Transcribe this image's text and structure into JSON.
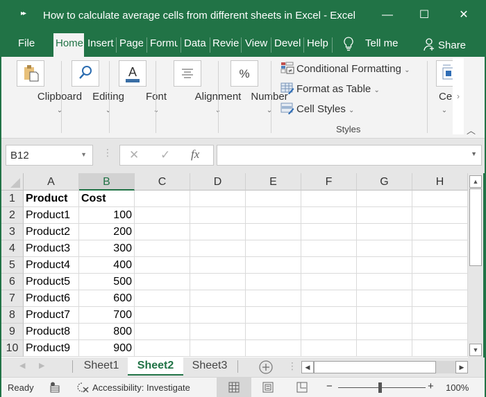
{
  "window": {
    "title": "How to calculate average cells from different sheets in Excel  -  Excel",
    "quick_access_icon": "more-icon",
    "minimize": "—",
    "maximize": "☐",
    "close": "✕"
  },
  "tabs": [
    {
      "label": "File",
      "active": false
    },
    {
      "label": "Home",
      "active": true
    },
    {
      "label": "Insert",
      "active": false
    },
    {
      "label": "Page",
      "active": false
    },
    {
      "label": "Formu",
      "active": false
    },
    {
      "label": "Data",
      "active": false
    },
    {
      "label": "Revie",
      "active": false
    },
    {
      "label": "View",
      "active": false
    },
    {
      "label": "Devel",
      "active": false
    },
    {
      "label": "Help",
      "active": false
    }
  ],
  "tell_me": {
    "label": "Tell me",
    "icon": "lightbulb-icon"
  },
  "share": {
    "label": "Share",
    "icon": "person-add-icon"
  },
  "ribbon": {
    "groups": [
      {
        "label": "Clipboard",
        "icon": "clipboard-icon"
      },
      {
        "label": "Editing",
        "icon": "search-icon"
      },
      {
        "label": "Font",
        "icon": "font-color-icon"
      },
      {
        "label": "Alignment",
        "icon": "align-center-icon"
      },
      {
        "label": "Number",
        "icon": "percent-icon"
      }
    ],
    "styles": {
      "items": [
        {
          "label": "Conditional Formatting",
          "icon": "conditional-formatting-icon"
        },
        {
          "label": "Format as Table",
          "icon": "format-table-icon"
        },
        {
          "label": "Cell Styles",
          "icon": "cell-styles-icon"
        }
      ],
      "group_label": "Styles"
    },
    "cells_group": {
      "label": "Ce"
    },
    "collapse_icon": "chevron-up-icon"
  },
  "formula_bar": {
    "name_box": "B12",
    "cancel_icon": "✕",
    "enter_icon": "✓",
    "fx_label": "fx",
    "formula": ""
  },
  "grid": {
    "columns": [
      "A",
      "B",
      "C",
      "D",
      "E",
      "F",
      "G",
      "H"
    ],
    "selected_column": "B",
    "rows": [
      {
        "n": "1",
        "a": "Product",
        "b": "Cost",
        "header": true
      },
      {
        "n": "2",
        "a": "Product1",
        "b": "100"
      },
      {
        "n": "3",
        "a": "Product2",
        "b": "200"
      },
      {
        "n": "4",
        "a": "Product3",
        "b": "300"
      },
      {
        "n": "5",
        "a": "Product4",
        "b": "400"
      },
      {
        "n": "6",
        "a": "Product5",
        "b": "500"
      },
      {
        "n": "7",
        "a": "Product6",
        "b": "600"
      },
      {
        "n": "8",
        "a": "Product7",
        "b": "700"
      },
      {
        "n": "9",
        "a": "Product8",
        "b": "800"
      },
      {
        "n": "10",
        "a": "Product9",
        "b": "900"
      }
    ]
  },
  "sheets": [
    {
      "label": "Sheet1",
      "active": false
    },
    {
      "label": "Sheet2",
      "active": true
    },
    {
      "label": "Sheet3",
      "active": false
    }
  ],
  "status": {
    "ready": "Ready",
    "accessibility": "Accessibility: Investigate",
    "zoom": "100%",
    "zoom_minus": "−",
    "zoom_plus": "+"
  },
  "colors": {
    "accent": "#217346"
  }
}
